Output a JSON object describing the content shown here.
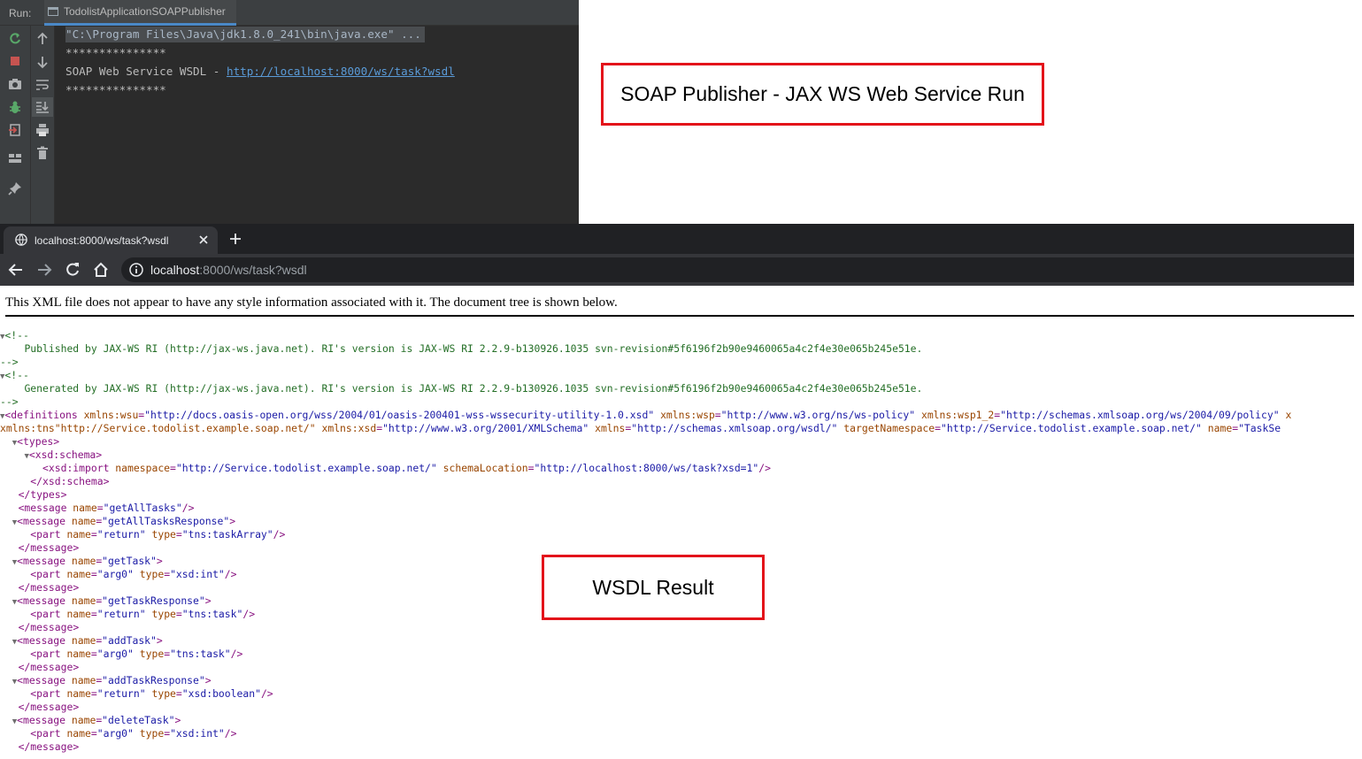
{
  "ide": {
    "run_label": "Run:",
    "run_tab_label": "TodolistApplicationSOAPPublisher",
    "console": {
      "command_line": "\"C:\\Program Files\\Java\\jdk1.8.0_241\\bin\\java.exe\" ...",
      "separator_top": "***************",
      "wsdl_prefix": "SOAP Web Service WSDL - ",
      "wsdl_link": "http://localhost:8000/ws/task?wsdl",
      "separator_bottom": "***************"
    },
    "toolbar_left_icons": [
      "rerun-icon",
      "stop-icon",
      "camera-icon",
      "debug-bug-icon",
      "exit-icon",
      "layout-icon",
      "pin-icon"
    ],
    "toolbar_right_icons": [
      "arrow-up-icon",
      "arrow-down-icon",
      "soft-wrap-icon",
      "scroll-to-end-icon",
      "print-icon",
      "trash-icon"
    ],
    "colors": {
      "background": "#2b2b2b",
      "toolbar": "#3c3f41",
      "link": "#5a9bd8"
    }
  },
  "annotations": {
    "soap": "SOAP Publisher - JAX WS Web Service Run",
    "wsdl": "WSDL Result"
  },
  "browser": {
    "tab_title": "localhost:8000/ws/task?wsdl",
    "url_host": "localhost",
    "url_path": ":8000/ws/task?wsdl"
  },
  "page": {
    "notice": "This XML file does not appear to have any style information associated with it. The document tree is shown below.",
    "lines": [
      "▼<!--",
      "    Published by JAX-WS RI (http://jax-ws.java.net). RI's version is JAX-WS RI 2.2.9-b130926.1035 svn-revision#5f6196f2b90e9460065a4c2f4e30e065b245e51e.",
      "-->",
      "▼<!--",
      "    Generated by JAX-WS RI (http://jax-ws.java.net). RI's version is JAX-WS RI 2.2.9-b130926.1035 svn-revision#5f6196f2b90e9460065a4c2f4e30e065b245e51e.",
      "-->",
      "▼<definitions xmlns:wsu=\"http://docs.oasis-open.org/wss/2004/01/oasis-200401-wss-wssecurity-utility-1.0.xsd\" xmlns:wsp=\"http://www.w3.org/ns/ws-policy\" xmlns:wsp1_2=\"http://schemas.xmlsoap.org/ws/2004/09/policy\" x",
      "xmlns:tns=\"http://Service.todolist.example.soap.net/\" xmlns:xsd=\"http://www.w3.org/2001/XMLSchema\" xmlns=\"http://schemas.xmlsoap.org/wsdl/\" targetNamespace=\"http://Service.todolist.example.soap.net/\" name=\"TaskSe",
      "  ▼<types>",
      "    ▼<xsd:schema>",
      "       <xsd:import namespace=\"http://Service.todolist.example.soap.net/\" schemaLocation=\"http://localhost:8000/ws/task?xsd=1\"/>",
      "     </xsd:schema>",
      "   </types>",
      "   <message name=\"getAllTasks\"/>",
      "  ▼<message name=\"getAllTasksResponse\">",
      "     <part name=\"return\" type=\"tns:taskArray\"/>",
      "   </message>",
      "  ▼<message name=\"getTask\">",
      "     <part name=\"arg0\" type=\"xsd:int\"/>",
      "   </message>",
      "  ▼<message name=\"getTaskResponse\">",
      "     <part name=\"return\" type=\"tns:task\"/>",
      "   </message>",
      "  ▼<message name=\"addTask\">",
      "     <part name=\"arg0\" type=\"tns:task\"/>",
      "   </message>",
      "  ▼<message name=\"addTaskResponse\">",
      "     <part name=\"return\" type=\"xsd:boolean\"/>",
      "   </message>",
      "  ▼<message name=\"deleteTask\">",
      "     <part name=\"arg0\" type=\"xsd:int\"/>",
      "   </message>"
    ],
    "colors": {
      "tag": "#881280",
      "comment": "#236e25",
      "attr": "#994500",
      "value": "#1a1aa6"
    }
  }
}
